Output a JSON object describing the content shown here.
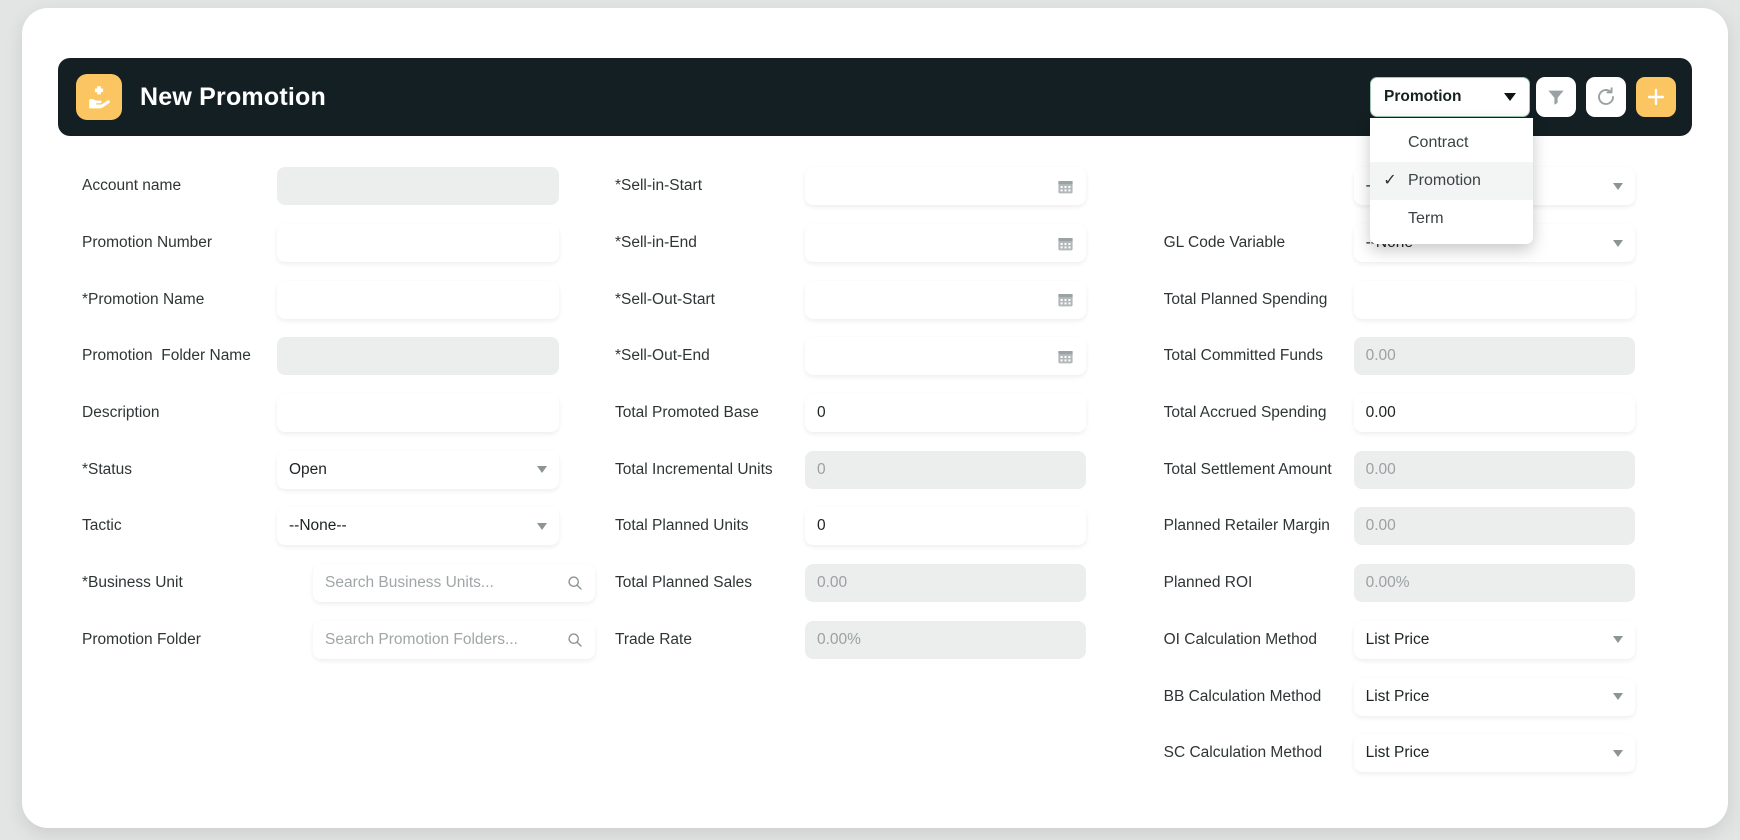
{
  "header": {
    "title": "New Promotion",
    "app_icon": "hand-holding-plus-icon",
    "type_selector": {
      "selected": "Promotion",
      "options": [
        "Contract",
        "Promotion",
        "Term"
      ]
    },
    "actions": [
      {
        "name": "filter-button",
        "icon": "filter-icon"
      },
      {
        "name": "refresh-button",
        "icon": "refresh-icon"
      },
      {
        "name": "add-button",
        "icon": "plus-icon"
      }
    ]
  },
  "colors": {
    "header_bg": "#131f22",
    "accent": "#fbc561",
    "selector_border": "#9fc7b4",
    "disabled_bg": "#eceeee",
    "page_bg": "#e3e5e4"
  },
  "form": {
    "column_left": [
      {
        "label": "Account name",
        "value": "",
        "state": "disabled",
        "control": "text"
      },
      {
        "label": "Promotion Number",
        "value": "",
        "state": "editable",
        "control": "text"
      },
      {
        "label": "*Promotion Name",
        "value": "",
        "state": "editable",
        "control": "text"
      },
      {
        "label": "Promotion  Folder Name",
        "value": "",
        "state": "disabled",
        "control": "text"
      },
      {
        "label": "Description",
        "value": "",
        "state": "editable",
        "control": "text"
      },
      {
        "label": "*Status",
        "value": "Open",
        "state": "editable",
        "control": "select"
      },
      {
        "label": "Tactic",
        "value": "--None--",
        "state": "editable",
        "control": "select"
      },
      {
        "label": "*Business Unit",
        "value": "",
        "placeholder": "Search Business Units...",
        "state": "editable",
        "control": "lookup"
      },
      {
        "label": "Promotion Folder",
        "value": "",
        "placeholder": "Search Promotion Folders...",
        "state": "editable",
        "control": "lookup"
      }
    ],
    "column_middle": [
      {
        "label": "*Sell-in-Start",
        "value": "",
        "state": "editable",
        "control": "date"
      },
      {
        "label": "*Sell-in-End",
        "value": "",
        "state": "editable",
        "control": "date"
      },
      {
        "label": "*Sell-Out-Start",
        "value": "",
        "state": "editable",
        "control": "date"
      },
      {
        "label": "*Sell-Out-End",
        "value": "",
        "state": "editable",
        "control": "date"
      },
      {
        "label": "Total Promoted Base",
        "value": "0",
        "state": "editable",
        "control": "text"
      },
      {
        "label": "Total Incremental Units",
        "value": "0",
        "state": "disabled",
        "control": "text"
      },
      {
        "label": "Total Planned Units",
        "value": "0",
        "state": "editable",
        "control": "text"
      },
      {
        "label": "Total Planned Sales",
        "value": "0.00",
        "state": "disabled",
        "control": "text"
      },
      {
        "label": "Trade Rate",
        "value": "0.00%",
        "state": "disabled",
        "control": "text"
      }
    ],
    "column_right": [
      {
        "label": "",
        "value": "--None--",
        "state": "editable",
        "control": "select"
      },
      {
        "label": "GL Code Variable",
        "value": "--None--",
        "state": "editable",
        "control": "select"
      },
      {
        "label": "Total Planned Spending",
        "value": "",
        "state": "editable",
        "control": "text"
      },
      {
        "label": "Total Committed Funds",
        "value": "0.00",
        "state": "disabled",
        "control": "text"
      },
      {
        "label": "Total Accrued Spending",
        "value": "0.00",
        "state": "editable",
        "control": "text"
      },
      {
        "label": "Total Settlement Amount",
        "value": "0.00",
        "state": "disabled",
        "control": "text"
      },
      {
        "label": "Planned Retailer Margin",
        "value": "0.00",
        "state": "disabled",
        "control": "text"
      },
      {
        "label": "Planned ROI",
        "value": "0.00%",
        "state": "disabled",
        "control": "text"
      },
      {
        "label": "OI Calculation Method",
        "value": "List Price",
        "state": "editable",
        "control": "select"
      },
      {
        "label": "BB Calculation Method",
        "value": "List Price",
        "state": "editable",
        "control": "select"
      },
      {
        "label": "SC Calculation Method",
        "value": "List Price",
        "state": "editable",
        "control": "select"
      }
    ]
  }
}
